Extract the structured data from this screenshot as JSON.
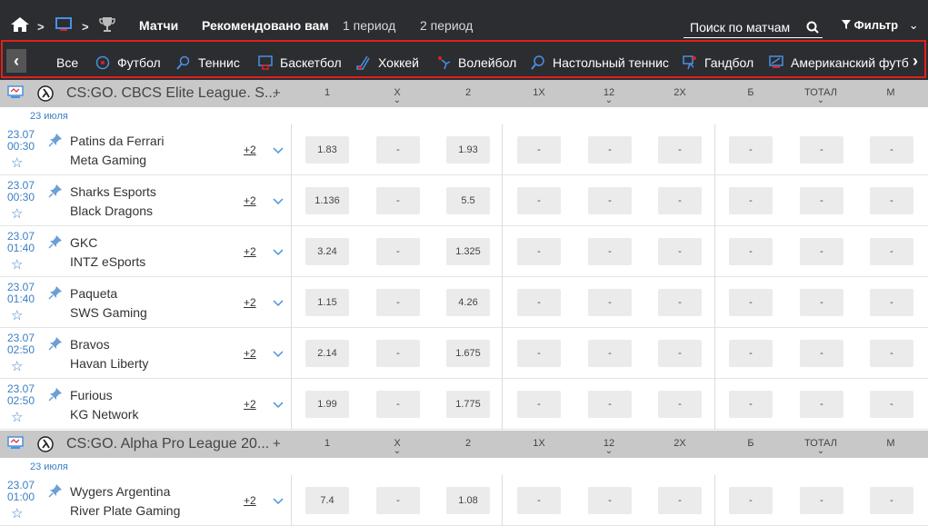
{
  "topbar": {
    "tabs": [
      "Матчи",
      "Рекомендовано вам",
      "1 период",
      "2 период"
    ],
    "search_placeholder": "Поиск по матчам",
    "filter_label": "Фильтр"
  },
  "sports": [
    "Все",
    "Футбол",
    "Теннис",
    "Баскетбол",
    "Хоккей",
    "Волейбол",
    "Настольный теннис",
    "Гандбол",
    "Американский футб"
  ],
  "columns": [
    "1",
    "X",
    "2",
    "1X",
    "12",
    "2X",
    "Б",
    "ТОТАЛ",
    "М"
  ],
  "leagues": [
    {
      "title": "CS:GO. CBCS Elite League. S...",
      "plus": "+",
      "date_label": "23 июля",
      "matches": [
        {
          "date": "23.07",
          "time": "00:30",
          "team1": "Patins da Ferrari",
          "team2": "Meta Gaming",
          "more": "+2",
          "odds": [
            "1.83",
            "-",
            "1.93",
            "-",
            "-",
            "-",
            "-",
            "-",
            "-"
          ]
        },
        {
          "date": "23.07",
          "time": "00:30",
          "team1": "Sharks Esports",
          "team2": "Black Dragons",
          "more": "+2",
          "odds": [
            "1.136",
            "-",
            "5.5",
            "-",
            "-",
            "-",
            "-",
            "-",
            "-"
          ]
        },
        {
          "date": "23.07",
          "time": "01:40",
          "team1": "GKC",
          "team2": "INTZ eSports",
          "more": "+2",
          "odds": [
            "3.24",
            "-",
            "1.325",
            "-",
            "-",
            "-",
            "-",
            "-",
            "-"
          ]
        },
        {
          "date": "23.07",
          "time": "01:40",
          "team1": "Paqueta",
          "team2": "SWS Gaming",
          "more": "+2",
          "odds": [
            "1.15",
            "-",
            "4.26",
            "-",
            "-",
            "-",
            "-",
            "-",
            "-"
          ]
        },
        {
          "date": "23.07",
          "time": "02:50",
          "team1": "Bravos",
          "team2": "Havan Liberty",
          "more": "+2",
          "odds": [
            "2.14",
            "-",
            "1.675",
            "-",
            "-",
            "-",
            "-",
            "-",
            "-"
          ]
        },
        {
          "date": "23.07",
          "time": "02:50",
          "team1": "Furious",
          "team2": "KG Network",
          "more": "+2",
          "odds": [
            "1.99",
            "-",
            "1.775",
            "-",
            "-",
            "-",
            "-",
            "-",
            "-"
          ]
        }
      ]
    },
    {
      "title": "CS:GO. Alpha Pro League 20...",
      "plus": "+",
      "date_label": "23 июля",
      "matches": [
        {
          "date": "23.07",
          "time": "01:00",
          "team1": "Wygers Argentina",
          "team2": "River Plate Gaming",
          "more": "+2",
          "odds": [
            "7.4",
            "-",
            "1.08",
            "-",
            "-",
            "-",
            "-",
            "-",
            "-"
          ]
        }
      ]
    }
  ],
  "colors": {
    "dark_bar": "#2b2d31",
    "league_bg": "#c8c8c8",
    "accent_blue": "#3b7fc4",
    "highlight_red": "#e0201f"
  }
}
